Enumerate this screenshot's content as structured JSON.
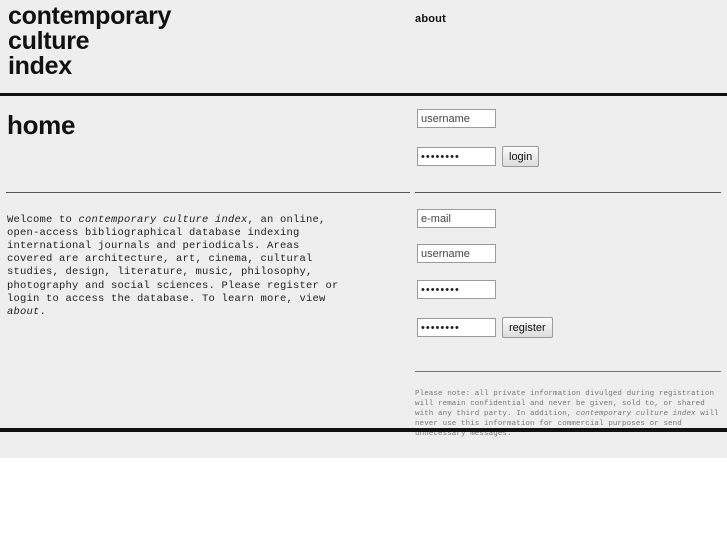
{
  "site": {
    "title_line1": "contemporary",
    "title_line2": "culture",
    "title_line3": "index"
  },
  "nav": {
    "about_label": "about"
  },
  "main": {
    "page_title": "home",
    "intro_prefix": "Welcome to ",
    "intro_emphasis": "contemporary culture index",
    "intro_body": ", an online, open-access bibliographical database indexing international journals and periodicals. Areas covered are architecture, art, cinema, cultural studies, design, literature, music, philosophy, photography and social sciences. Please register or login to access the database. To learn more, view ",
    "intro_emphasis2": "about",
    "intro_suffix": "."
  },
  "login_form": {
    "username_placeholder": "username",
    "username_value": "username",
    "password_value": "••••••••",
    "submit_label": "login"
  },
  "register_form": {
    "email_placeholder": "e-mail",
    "email_value": "e-mail",
    "username_placeholder": "username",
    "username_value": "username",
    "password_value": "••••••••",
    "password_confirm_value": "••••••••",
    "submit_label": "register"
  },
  "privacy": {
    "text_part1": "Please note: all private information divulged during registration will remain confidential and never be given, sold to, or shared with any third party. In addition, ",
    "emphasis": "contemporary culture index",
    "text_part2": " will never use this information for commercial purposes or send unnecessary messages."
  },
  "colors": {
    "background": "#eeeeee",
    "rule": "#111111",
    "text": "#222222",
    "muted": "#777777"
  }
}
